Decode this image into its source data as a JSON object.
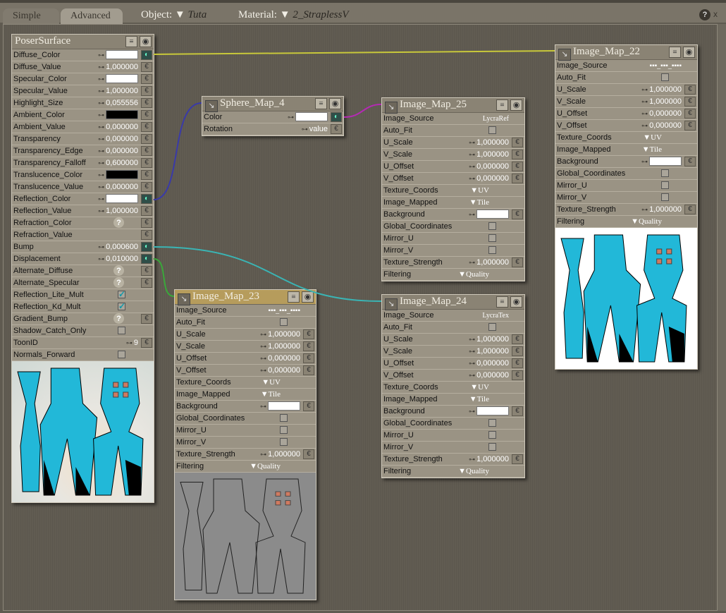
{
  "header": {
    "tabs": [
      "Simple",
      "Advanced"
    ],
    "active_tab": "Advanced",
    "object_label": "Object:",
    "object_value": "Tuta",
    "material_label": "Material:",
    "material_value": "2_StraplessV",
    "help": "?",
    "close": "x"
  },
  "colors": {
    "wire_yellow": "#c8c83a",
    "wire_blue": "#3a3aa8",
    "wire_magenta": "#b42ab4",
    "wire_cyan": "#3ab4b4",
    "wire_green": "#3aa83a",
    "cyan": "#22b8d8"
  },
  "nodes": [
    {
      "id": "posersurface",
      "title": "PoserSurface",
      "rows": [
        [
          "Diffuse_Color",
          "color",
          "#ffffff",
          "on"
        ],
        [
          "Diffuse_Value",
          "num",
          "1,000000",
          "p"
        ],
        [
          "Specular_Color",
          "color",
          "#ffffff",
          "p"
        ],
        [
          "Specular_Value",
          "num",
          "1,000000",
          "p"
        ],
        [
          "Highlight_Size",
          "num",
          "0,055556",
          "p"
        ],
        [
          "Ambient_Color",
          "color",
          "#000000",
          "p"
        ],
        [
          "Ambient_Value",
          "num",
          "0,000000",
          "p"
        ],
        [
          "Transparency",
          "num",
          "0,000000",
          "p"
        ],
        [
          "Transparency_Edge",
          "num",
          "0,000000",
          "p"
        ],
        [
          "Transparency_Falloff",
          "num",
          "0,600000",
          "p"
        ],
        [
          "Translucence_Color",
          "color",
          "#000000",
          "p"
        ],
        [
          "Translucence_Value",
          "num",
          "0,000000",
          "p"
        ],
        [
          "Reflection_Color",
          "color",
          "#ffffff",
          "on"
        ],
        [
          "Reflection_Value",
          "num",
          "1,000000",
          "p"
        ],
        [
          "Refraction_Color",
          "help",
          "?",
          "p"
        ],
        [
          "Refraction_Value",
          "none",
          "",
          "p"
        ],
        [
          "Bump",
          "num",
          "0,000600",
          "on"
        ],
        [
          "Displacement",
          "num",
          "0,010000",
          "on"
        ],
        [
          "Alternate_Diffuse",
          "help",
          "?",
          "p"
        ],
        [
          "Alternate_Specular",
          "help",
          "?",
          "p"
        ],
        [
          "Reflection_Lite_Mult",
          "check",
          "✓",
          ""
        ],
        [
          "Reflection_Kd_Mult",
          "check",
          "✓",
          ""
        ],
        [
          "Gradient_Bump",
          "help",
          "?",
          "p"
        ],
        [
          "Shadow_Catch_Only",
          "check",
          "",
          ""
        ],
        [
          "ToonID",
          "num",
          "9",
          "p"
        ],
        [
          "Normals_Forward",
          "check",
          "",
          ""
        ]
      ]
    },
    {
      "id": "sphere-map-4",
      "title": "Sphere_Map_4",
      "rows": [
        [
          "Color",
          "color",
          "#ffffff",
          "on"
        ],
        [
          "Rotation",
          "num",
          "value",
          "p"
        ]
      ]
    },
    {
      "id": "image-map-25",
      "title": "Image_Map_25",
      "rows": [
        [
          "Image_Source",
          "text",
          "LycraRef",
          ""
        ],
        [
          "Auto_Fit",
          "check",
          "",
          ""
        ],
        [
          "U_Scale",
          "num",
          "1,000000",
          "p"
        ],
        [
          "V_Scale",
          "num",
          "1,000000",
          "p"
        ],
        [
          "U_Offset",
          "num",
          "0,000000",
          "p"
        ],
        [
          "V_Offset",
          "num",
          "0,000000",
          "p"
        ],
        [
          "Texture_Coords",
          "dd",
          "▼UV",
          ""
        ],
        [
          "Image_Mapped",
          "dd",
          "▼Tile",
          ""
        ],
        [
          "Background",
          "color",
          "#ffffff",
          "p"
        ],
        [
          "Global_Coordinates",
          "check",
          "",
          ""
        ],
        [
          "Mirror_U",
          "check",
          "",
          ""
        ],
        [
          "Mirror_V",
          "check",
          "",
          ""
        ],
        [
          "Texture_Strength",
          "num",
          "1,000000",
          "p"
        ],
        [
          "Filtering",
          "dd",
          "▼Quality",
          ""
        ]
      ]
    },
    {
      "id": "image-map-22",
      "title": "Image_Map_22",
      "rows": [
        [
          "Image_Source",
          "text",
          "▪▪▪_▪▪▪_▪▪▪▪",
          ""
        ],
        [
          "Auto_Fit",
          "check",
          "",
          ""
        ],
        [
          "U_Scale",
          "num",
          "1,000000",
          "p"
        ],
        [
          "V_Scale",
          "num",
          "1,000000",
          "p"
        ],
        [
          "U_Offset",
          "num",
          "0,000000",
          "p"
        ],
        [
          "V_Offset",
          "num",
          "0,000000",
          "p"
        ],
        [
          "Texture_Coords",
          "dd",
          "▼UV",
          ""
        ],
        [
          "Image_Mapped",
          "dd",
          "▼Tile",
          ""
        ],
        [
          "Background",
          "color",
          "#ffffff",
          "p"
        ],
        [
          "Global_Coordinates",
          "check",
          "",
          ""
        ],
        [
          "Mirror_U",
          "check",
          "",
          ""
        ],
        [
          "Mirror_V",
          "check",
          "",
          ""
        ],
        [
          "Texture_Strength",
          "num",
          "1,000000",
          "p"
        ],
        [
          "Filtering",
          "dd",
          "▼Quality",
          ""
        ]
      ]
    },
    {
      "id": "image-map-23",
      "title": "Image_Map_23",
      "rows": [
        [
          "Image_Source",
          "text",
          "▪▪▪_▪▪▪_▪▪▪▪",
          ""
        ],
        [
          "Auto_Fit",
          "check",
          "",
          ""
        ],
        [
          "U_Scale",
          "num",
          "1,000000",
          "p"
        ],
        [
          "V_Scale",
          "num",
          "1,000000",
          "p"
        ],
        [
          "U_Offset",
          "num",
          "0,000000",
          "p"
        ],
        [
          "V_Offset",
          "num",
          "0,000000",
          "p"
        ],
        [
          "Texture_Coords",
          "dd",
          "▼UV",
          ""
        ],
        [
          "Image_Mapped",
          "dd",
          "▼Tile",
          ""
        ],
        [
          "Background",
          "color",
          "#ffffff",
          "p"
        ],
        [
          "Global_Coordinates",
          "check",
          "",
          ""
        ],
        [
          "Mirror_U",
          "check",
          "",
          ""
        ],
        [
          "Mirror_V",
          "check",
          "",
          ""
        ],
        [
          "Texture_Strength",
          "num",
          "1,000000",
          "p"
        ],
        [
          "Filtering",
          "dd",
          "▼Quality",
          ""
        ]
      ]
    },
    {
      "id": "image-map-24",
      "title": "Image_Map_24",
      "rows": [
        [
          "Image_Source",
          "text",
          "LycraTex",
          ""
        ],
        [
          "Auto_Fit",
          "check",
          "",
          ""
        ],
        [
          "U_Scale",
          "num",
          "1,000000",
          "p"
        ],
        [
          "V_Scale",
          "num",
          "1,000000",
          "p"
        ],
        [
          "U_Offset",
          "num",
          "0,000000",
          "p"
        ],
        [
          "V_Offset",
          "num",
          "0,000000",
          "p"
        ],
        [
          "Texture_Coords",
          "dd",
          "▼UV",
          ""
        ],
        [
          "Image_Mapped",
          "dd",
          "▼Tile",
          ""
        ],
        [
          "Background",
          "color",
          "#ffffff",
          "p"
        ],
        [
          "Global_Coordinates",
          "check",
          "",
          ""
        ],
        [
          "Mirror_U",
          "check",
          "",
          ""
        ],
        [
          "Mirror_V",
          "check",
          "",
          ""
        ],
        [
          "Texture_Strength",
          "num",
          "1,000000",
          "p"
        ],
        [
          "Filtering",
          "dd",
          "▼Quality",
          ""
        ]
      ]
    }
  ]
}
